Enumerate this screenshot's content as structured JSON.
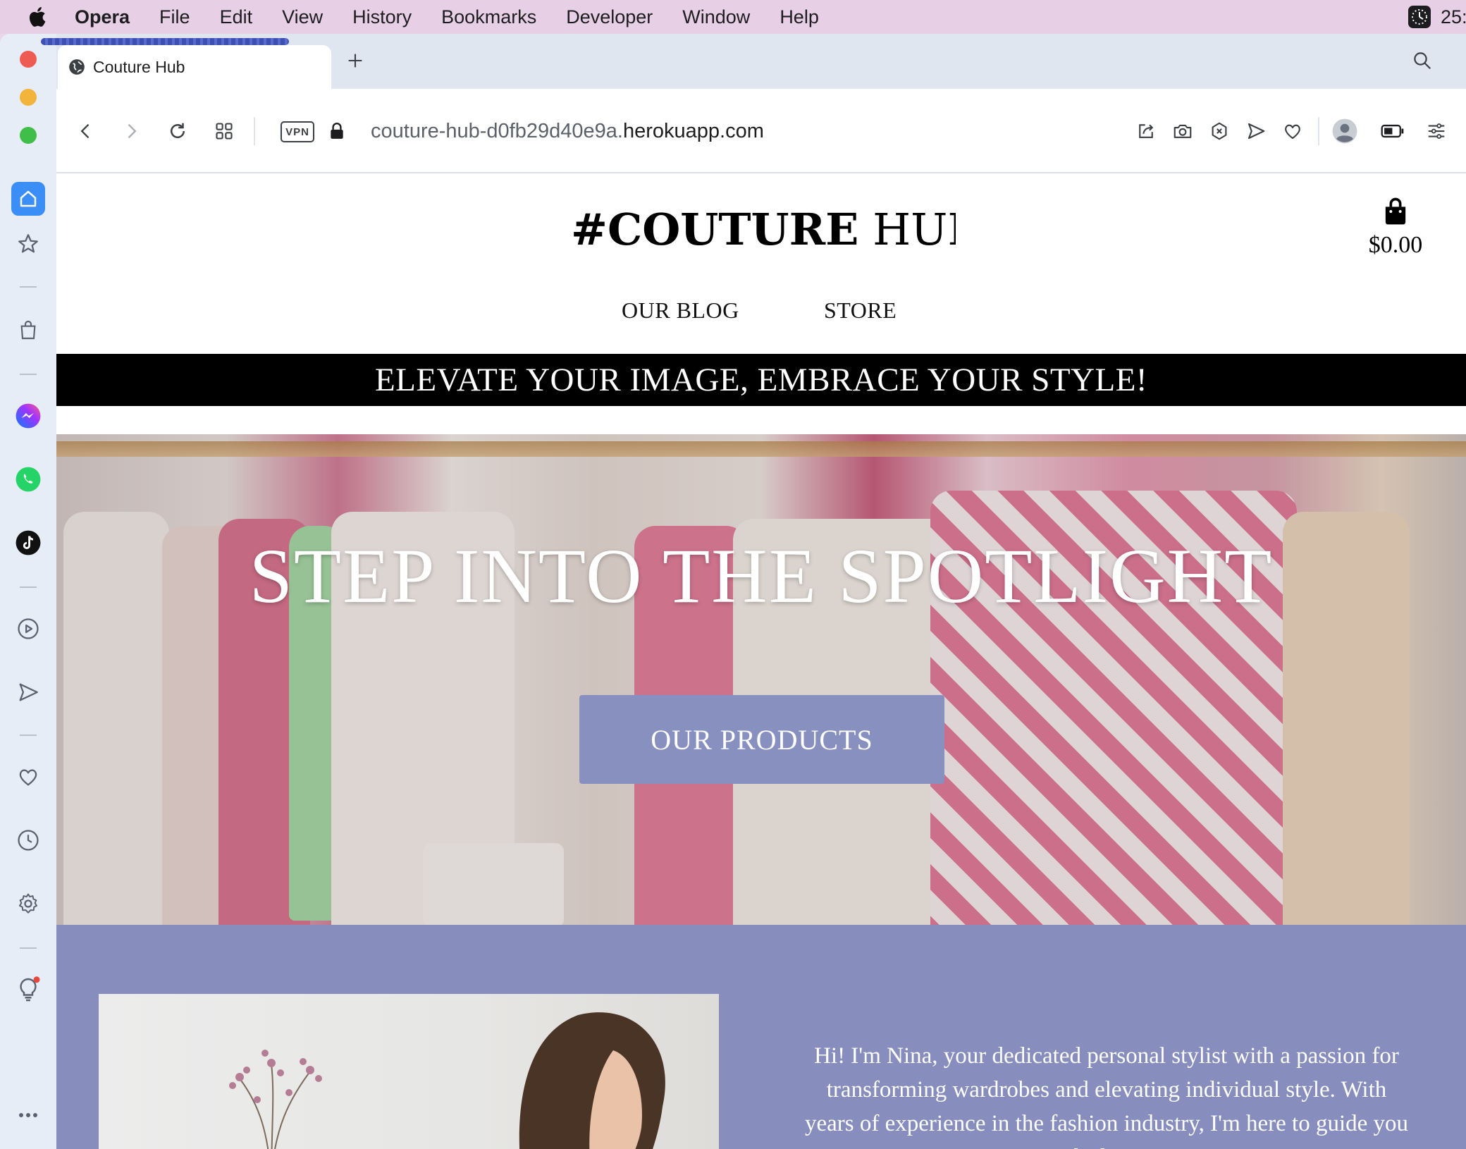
{
  "menubar": {
    "app_name": "Opera",
    "items": [
      "File",
      "Edit",
      "View",
      "History",
      "Bookmarks",
      "Developer",
      "Window",
      "Help"
    ],
    "clock_text": "25:"
  },
  "browser": {
    "tab_title": "Couture Hub",
    "address": {
      "subdomain": "couture-hub-d0fb29d40e9a.",
      "domain": "herokuapp.com"
    },
    "vpn_label": "VPN"
  },
  "site": {
    "logo_bold": "#COUTURE",
    "logo_rest": " HUB !",
    "cart_total": "$0.00",
    "nav": [
      "OUR BLOG",
      "STORE"
    ],
    "banner": "ELEVATE YOUR IMAGE, EMBRACE YOUR STYLE!",
    "hero_title": "STEP INTO THE SPOTLIGHT",
    "hero_button": "OUR PRODUCTS",
    "about_text": "Hi! I'm Nina, your dedicated personal stylist with a passion for transforming wardrobes and elevating individual style. With years of experience in the fashion industry, I'm here to guide you on a journey towards discovering your unique"
  },
  "colors": {
    "accent": "#8890bf",
    "about_bg": "#878ebd",
    "banner_bg": "#000000",
    "menubar_bg": "#e7cfe6"
  }
}
